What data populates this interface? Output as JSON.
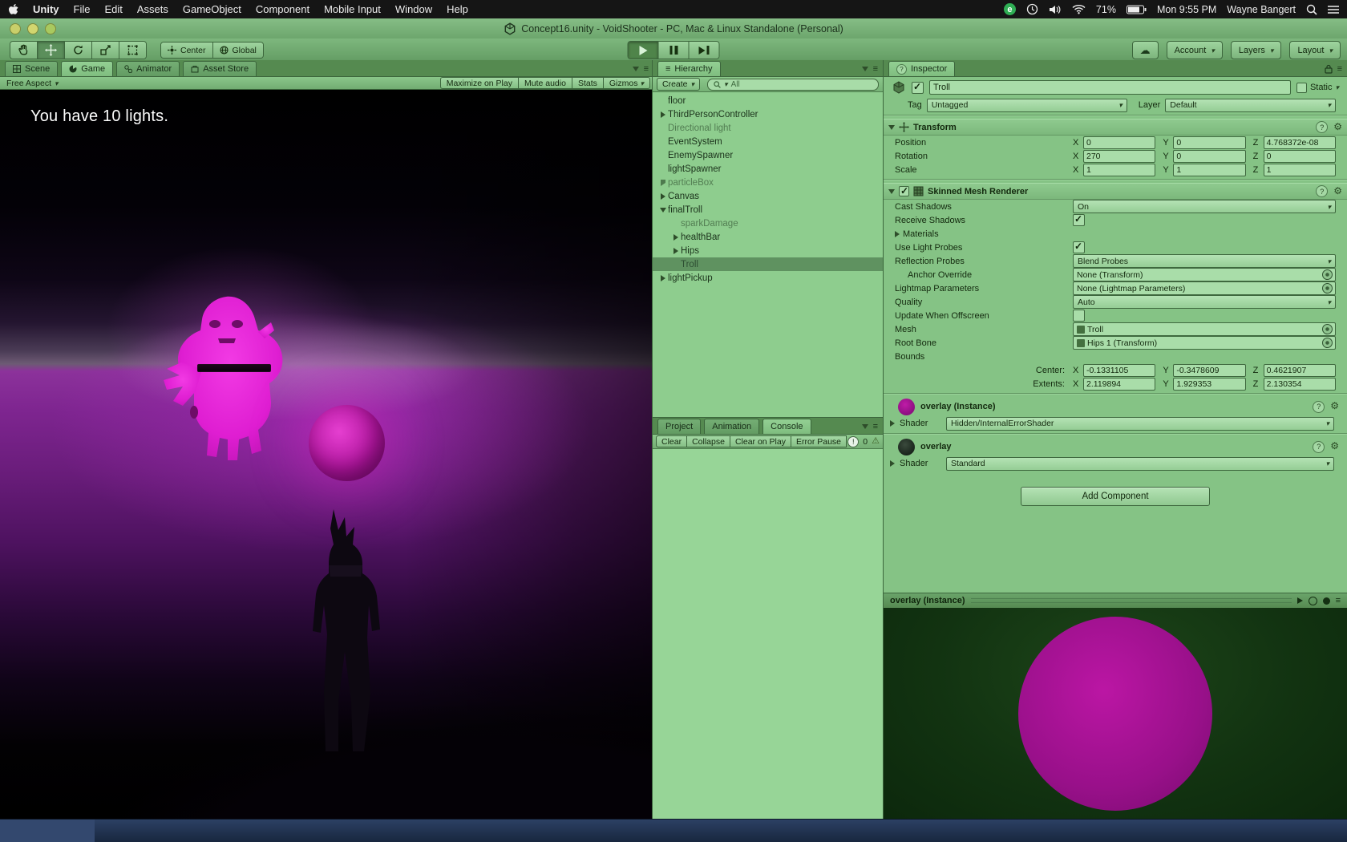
{
  "colors": {
    "selection_green": "#5f9260",
    "troll_magenta": "#e21fd2",
    "orb_magenta": "#b517a2",
    "preview_magenta": "#a2128d",
    "dock_navy": "#1b2b47"
  },
  "menu_bar": {
    "items": [
      "Unity",
      "File",
      "Edit",
      "Assets",
      "GameObject",
      "Component",
      "Mobile Input",
      "Window",
      "Help"
    ],
    "battery": "71%",
    "clock": "Mon 9:55 PM",
    "user": "Wayne Bangert"
  },
  "window": {
    "title": "Concept16.unity - VoidShooter - PC, Mac & Linux Standalone (Personal)"
  },
  "toolbar": {
    "center": "Center",
    "global": "Global",
    "account": "Account",
    "layers": "Layers",
    "layout": "Layout"
  },
  "panels": {
    "left_tabs": [
      "Scene",
      "Game",
      "Animator",
      "Asset Store"
    ],
    "game_bar": {
      "aspect": "Free Aspect",
      "maximize": "Maximize on Play",
      "mute": "Mute audio",
      "stats": "Stats",
      "gizmos": "Gizmos"
    },
    "game_message": "You have 10 lights."
  },
  "hierarchy": {
    "title": "Hierarchy",
    "create_label": "Create",
    "search_filter": "All",
    "items": [
      {
        "label": "floor"
      },
      {
        "label": "ThirdPersonController"
      },
      {
        "label": "Directional light"
      },
      {
        "label": "EventSystem"
      },
      {
        "label": "EnemySpawner"
      },
      {
        "label": "lightSpawner"
      },
      {
        "label": "particleBox"
      },
      {
        "label": "Canvas"
      },
      {
        "label": "finalTroll"
      },
      {
        "label": "sparkDamage"
      },
      {
        "label": "healthBar"
      },
      {
        "label": "Hips"
      },
      {
        "label": "Troll"
      },
      {
        "label": "lightPickup"
      }
    ]
  },
  "console": {
    "tabs": [
      "Project",
      "Animation",
      "Console"
    ],
    "clear": "Clear",
    "collapse": "Collapse",
    "clear_on_play": "Clear on Play",
    "error_pause": "Error Pause",
    "info_count": "0"
  },
  "inspector": {
    "title": "Inspector",
    "name": "Troll",
    "static_label": "Static",
    "tag_label": "Tag",
    "tag_value": "Untagged",
    "layer_label": "Layer",
    "layer_value": "Default",
    "axis": {
      "x": "X",
      "y": "Y",
      "z": "Z"
    },
    "transform": {
      "title": "Transform",
      "position": {
        "label": "Position",
        "x": "0",
        "y": "0",
        "z": "4.768372e-08"
      },
      "rotation": {
        "label": "Rotation",
        "x": "270",
        "y": "0",
        "z": "0"
      },
      "scale": {
        "label": "Scale",
        "x": "1",
        "y": "1",
        "z": "1"
      }
    },
    "smr": {
      "title": "Skinned Mesh Renderer",
      "cast_shadows": {
        "label": "Cast Shadows",
        "value": "On"
      },
      "receive_shadows": {
        "label": "Receive Shadows"
      },
      "materials": {
        "label": "Materials"
      },
      "use_light_probes": {
        "label": "Use Light Probes"
      },
      "reflection_probes": {
        "label": "Reflection Probes",
        "value": "Blend Probes"
      },
      "anchor_override": {
        "label": "Anchor Override",
        "value": "None (Transform)"
      },
      "lightmap_parameters": {
        "label": "Lightmap Parameters",
        "value": "None (Lightmap Parameters)"
      },
      "quality": {
        "label": "Quality",
        "value": "Auto"
      },
      "update_when_offscreen": {
        "label": "Update When Offscreen"
      },
      "mesh": {
        "label": "Mesh",
        "value": "Troll"
      },
      "root_bone": {
        "label": "Root Bone",
        "value": "Hips 1 (Transform)"
      },
      "bounds_label": "Bounds",
      "center": {
        "label": "Center:",
        "x": "-0.1331105",
        "y": "-0.3478609",
        "z": "0.4621907"
      },
      "extents": {
        "label": "Extents:",
        "x": "2.119894",
        "y": "1.929353",
        "z": "2.130354"
      }
    },
    "materials": [
      {
        "name": "overlay (Instance)",
        "shader_label": "Shader",
        "shader": "Hidden/InternalErrorShader"
      },
      {
        "name": "overlay",
        "shader_label": "Shader",
        "shader": "Standard"
      }
    ],
    "add_component": "Add Component",
    "preview_title": "overlay (Instance)"
  }
}
